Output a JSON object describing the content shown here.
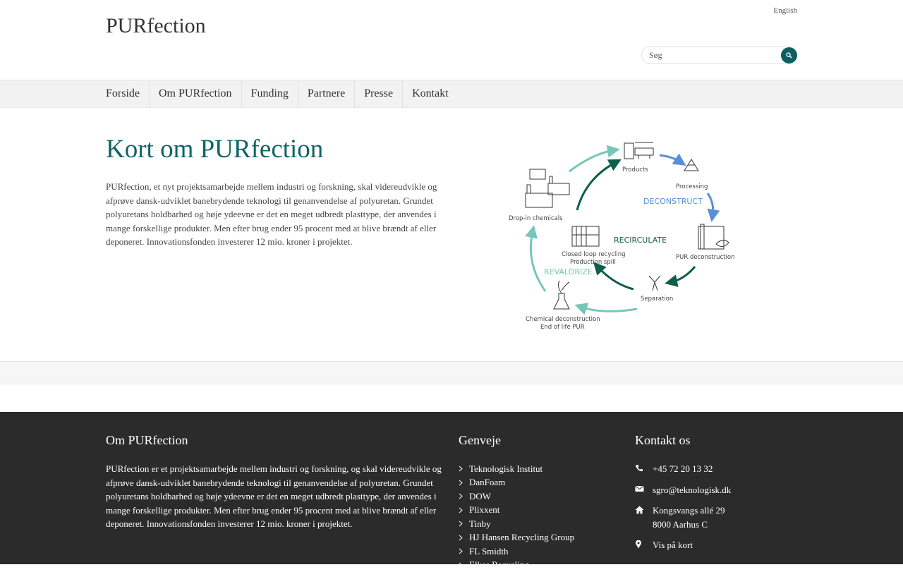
{
  "header": {
    "site_title": "PURfection",
    "language_link": "English",
    "search_placeholder": "Søg"
  },
  "nav": {
    "items": [
      "Forside",
      "Om PURfection",
      "Funding",
      "Partnere",
      "Presse",
      "Kontakt"
    ]
  },
  "main": {
    "title": "Kort om PURfection",
    "text": "PURfection, et nyt projektsamarbejde mellem industri og forskning, skal videreudvikle og afprøve dansk-udviklet banebrydende teknologi til genanvendelse af polyuretan. Grundet polyuretans holdbarhed og høje ydeevne er det en meget udbredt plasttype, der anvendes i mange forskellige produkter. Men efter brug ender 95 procent med at blive brændt af eller deponeret. Innovationsfonden investerer 12 mio. kroner i projektet."
  },
  "diagram": {
    "products": "Products",
    "processing": "Processing",
    "deconstruct": "DECONSTRUCT",
    "pur_deconstruction": "PUR deconstruction",
    "separation": "Separation",
    "chemical_deconstruction": "Chemical deconstruction",
    "end_of_life": "End of life PUR",
    "revalorize": "REVALORIZE",
    "drop_in": "Drop-in chemicals",
    "recirculate": "RECIRCULATE",
    "closed_loop": "Closed loop recycling",
    "production_spill": "Production spill",
    "colors": {
      "teal_light": "#76c7b8",
      "teal_dark": "#0d5e4d",
      "blue": "#5a8fd8"
    }
  },
  "footer": {
    "about_title": "Om PURfection",
    "about_text": "PURfection er et projektsamarbejde mellem industri og forskning, og skal videreudvikle og afprøve dansk-udviklet banebrydende teknologi til genanvendelse af polyuretan. Grundet polyuretans holdbarhed og høje ydeevne er det en meget udbredt plasttype, der anvendes i mange forskellige produkter. Men efter brug ender 95 procent med at blive brændt af eller deponeret. Innovationsfonden investerer 12 mio. kroner i projektet.",
    "links_title": "Genveje",
    "links": [
      "Teknologisk Institut",
      "DanFoam",
      "DOW",
      "Plixxent",
      "Tinby",
      "HJ Hansen Recycling Group",
      "FL Smidth",
      "Elkas Recycling"
    ],
    "contact_title": "Kontakt os",
    "phone": "+45 72 20 13 32",
    "email": "sgro@teknologisk.dk",
    "address_line1": "Kongsvangs allé 29",
    "address_line2": "8000 Aarhus C",
    "map_link": "Vis på kort"
  }
}
